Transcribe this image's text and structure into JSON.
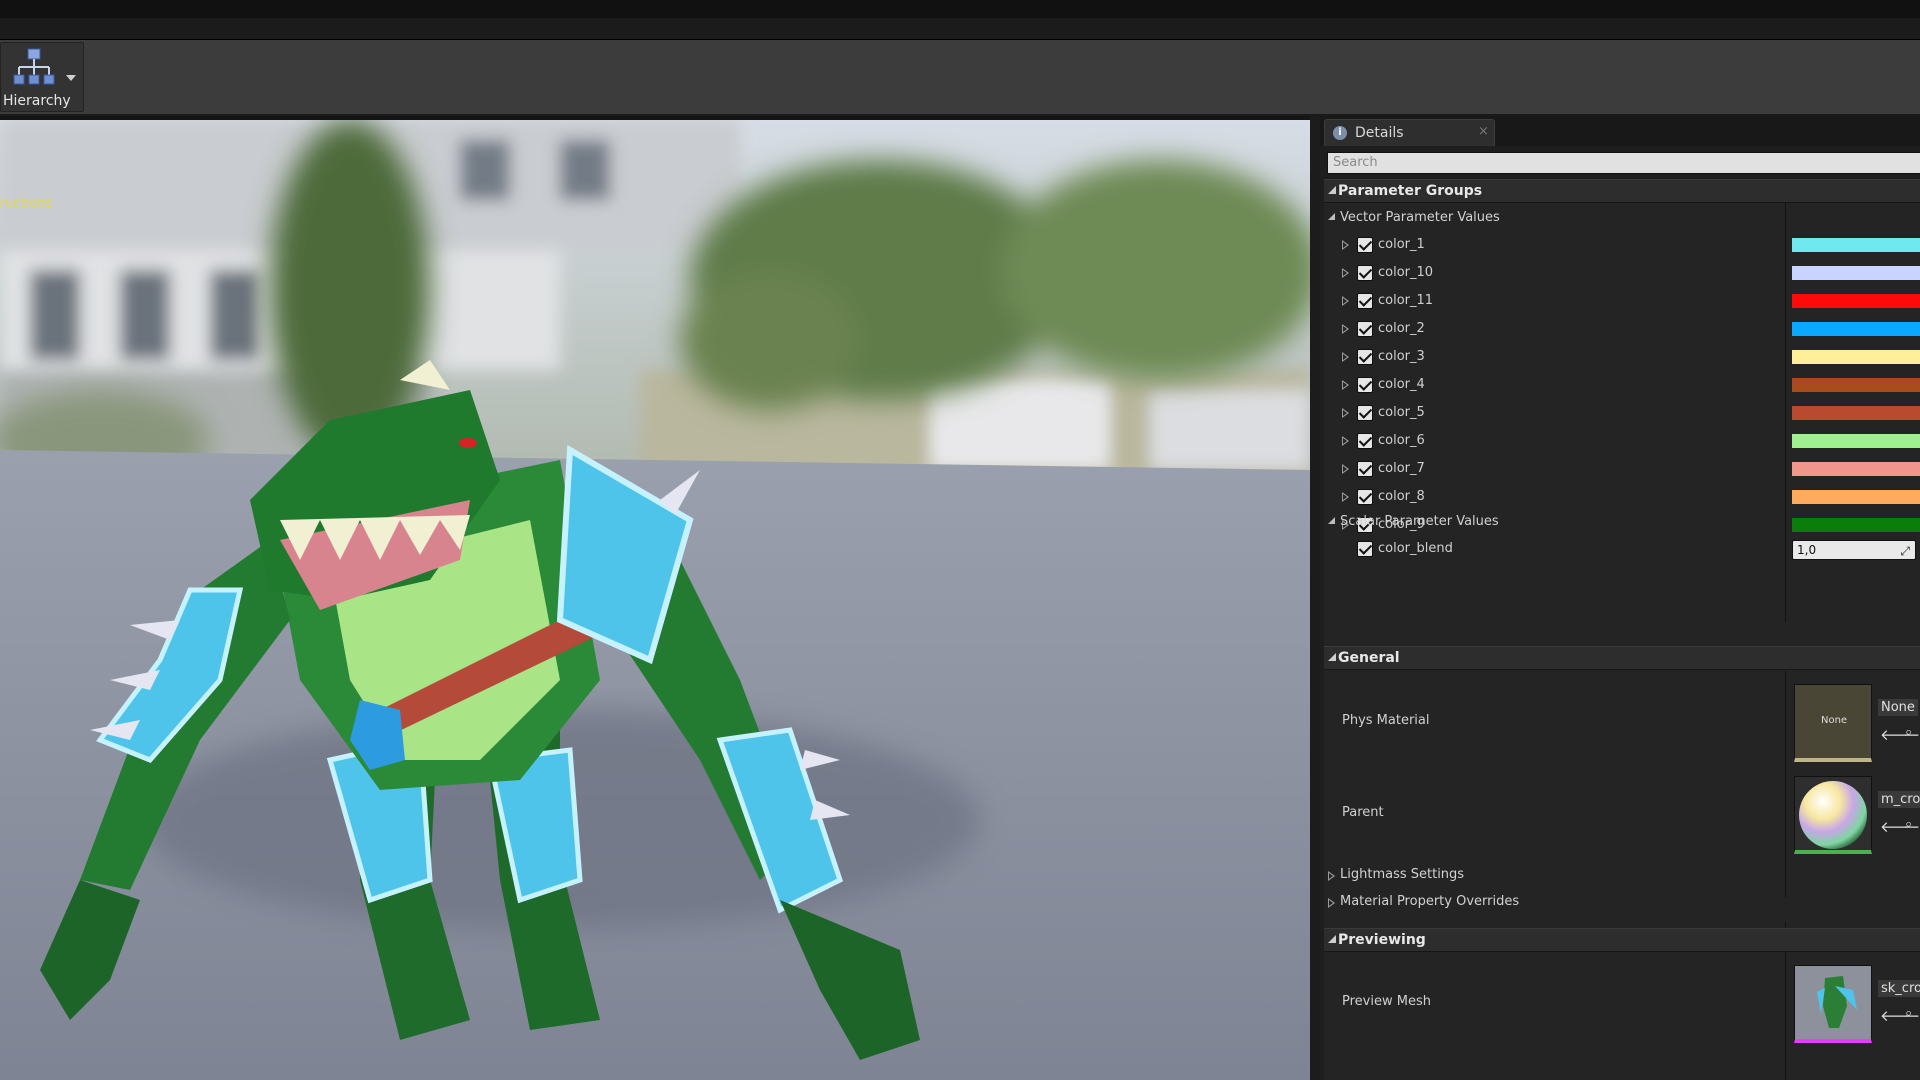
{
  "toolbar": {
    "hierarchy_label": "Hierarchy",
    "hierarchy_icon": "hierarchy-icon"
  },
  "viewport": {
    "hint_text": "ructions"
  },
  "details": {
    "tab_label": "Details",
    "tab_icon": "info-icon",
    "tab_close": "×",
    "search_placeholder": "Search",
    "parameter_groups": {
      "title": "Parameter Groups",
      "vector_title": "Vector Parameter Values",
      "vector_params": [
        {
          "name": "color_1",
          "enabled": true,
          "color": "#6fe8f0"
        },
        {
          "name": "color_10",
          "enabled": true,
          "color": "#c8d4ff"
        },
        {
          "name": "color_11",
          "enabled": true,
          "color": "#ff0a0a"
        },
        {
          "name": "color_2",
          "enabled": true,
          "color": "#0aa8ff"
        },
        {
          "name": "color_3",
          "enabled": true,
          "color": "#ffef9a"
        },
        {
          "name": "color_4",
          "enabled": true,
          "color": "#a84c1c"
        },
        {
          "name": "color_5",
          "enabled": true,
          "color": "#b84a30"
        },
        {
          "name": "color_6",
          "enabled": true,
          "color": "#9ef28e"
        },
        {
          "name": "color_7",
          "enabled": true,
          "color": "#f0968a"
        },
        {
          "name": "color_8",
          "enabled": true,
          "color": "#ffab5e"
        },
        {
          "name": "color_9",
          "enabled": true,
          "color": "#0a7d0a"
        }
      ],
      "scalar_title": "Scalar Parameter Values",
      "scalar_params": [
        {
          "name": "color_blend",
          "enabled": true,
          "value": "1,0"
        }
      ]
    },
    "general": {
      "title": "General",
      "phys_material_label": "Phys Material",
      "phys_material_thumb_text": "None",
      "phys_material_value": "None",
      "parent_label": "Parent",
      "parent_value": "m_croc",
      "lightmass_label": "Lightmass Settings",
      "overrides_label": "Material Property Overrides"
    },
    "previewing": {
      "title": "Previewing",
      "preview_mesh_label": "Preview Mesh",
      "preview_mesh_value": "sk_croc"
    }
  }
}
